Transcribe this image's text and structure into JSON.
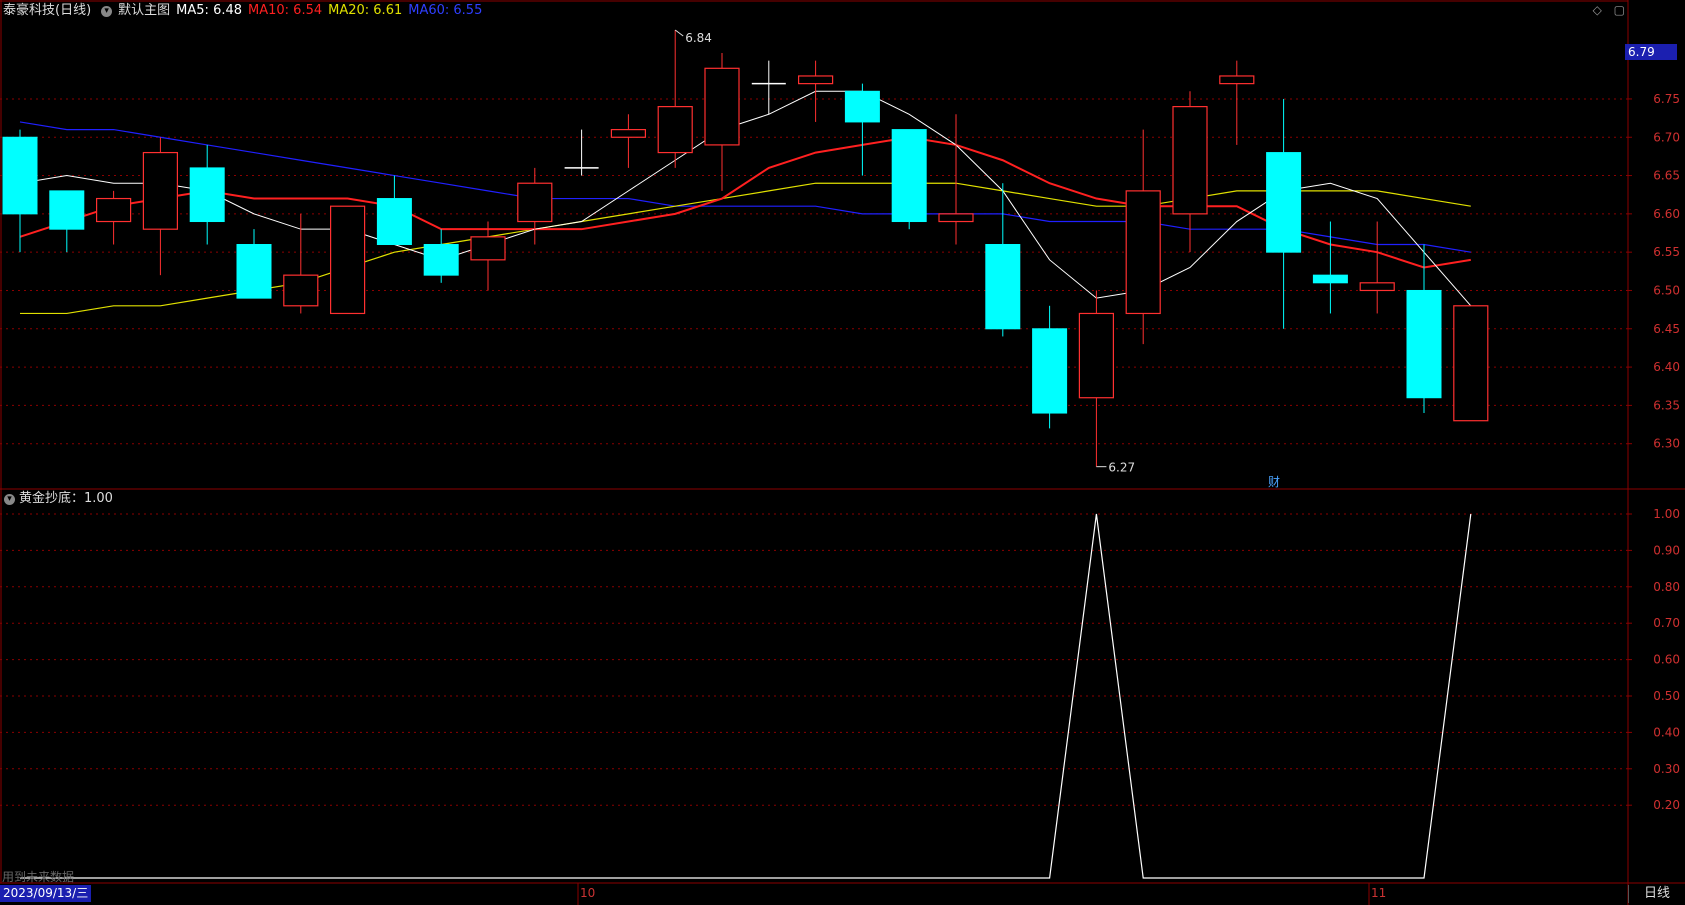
{
  "header": {
    "stock_title": "泰豪科技(日线)",
    "chart_label": "默认主图",
    "ma5": "MA5: 6.48",
    "ma10": "MA10: 6.54",
    "ma20": "MA20: 6.61",
    "ma60": "MA60: 6.55",
    "ma5_color": "#ffffff",
    "ma10_color": "#ff2020",
    "ma20_color": "#e0e000",
    "ma60_color": "#2020ff"
  },
  "indicator_header": {
    "label": "黄金抄底：1.00"
  },
  "current_price_tag": "6.79",
  "annotations": {
    "high": "6.84",
    "low": "6.27",
    "finance_mark": "财"
  },
  "footer": {
    "future_data_note": "用到未来数据",
    "cursor_date": "2023/09/13/三",
    "period": "日线",
    "month_10": "10",
    "month_11": "11"
  },
  "price_axis": [
    "6.75",
    "6.70",
    "6.65",
    "6.60",
    "6.55",
    "6.50",
    "6.45",
    "6.40",
    "6.35",
    "6.30"
  ],
  "indicator_axis": [
    "1.00",
    "0.90",
    "0.80",
    "0.70",
    "0.60",
    "0.50",
    "0.40",
    "0.30",
    "0.20"
  ],
  "colors": {
    "up": "#ff3030",
    "down": "#00ffff",
    "grid": "#8b0000",
    "bg": "#000000"
  },
  "chart_data": {
    "type": "candlestick",
    "candles": [
      {
        "o": 6.7,
        "h": 6.71,
        "l": 6.55,
        "c": 6.6
      },
      {
        "o": 6.63,
        "h": 6.63,
        "l": 6.55,
        "c": 6.58
      },
      {
        "o": 6.59,
        "h": 6.63,
        "l": 6.56,
        "c": 6.62
      },
      {
        "o": 6.58,
        "h": 6.7,
        "l": 6.52,
        "c": 6.68
      },
      {
        "o": 6.66,
        "h": 6.69,
        "l": 6.56,
        "c": 6.59
      },
      {
        "o": 6.56,
        "h": 6.58,
        "l": 6.49,
        "c": 6.49
      },
      {
        "o": 6.48,
        "h": 6.6,
        "l": 6.47,
        "c": 6.52
      },
      {
        "o": 6.47,
        "h": 6.61,
        "l": 6.47,
        "c": 6.61
      },
      {
        "o": 6.62,
        "h": 6.65,
        "l": 6.56,
        "c": 6.56
      },
      {
        "o": 6.56,
        "h": 6.58,
        "l": 6.51,
        "c": 6.52
      },
      {
        "o": 6.54,
        "h": 6.59,
        "l": 6.5,
        "c": 6.57
      },
      {
        "o": 6.59,
        "h": 6.66,
        "l": 6.56,
        "c": 6.64
      },
      {
        "o": 6.66,
        "h": 6.71,
        "l": 6.65,
        "c": 6.66
      },
      {
        "o": 6.7,
        "h": 6.73,
        "l": 6.66,
        "c": 6.71
      },
      {
        "o": 6.68,
        "h": 6.84,
        "l": 6.66,
        "c": 6.74
      },
      {
        "o": 6.69,
        "h": 6.81,
        "l": 6.63,
        "c": 6.79
      },
      {
        "o": 6.77,
        "h": 6.8,
        "l": 6.73,
        "c": 6.77
      },
      {
        "o": 6.77,
        "h": 6.8,
        "l": 6.72,
        "c": 6.78
      },
      {
        "o": 6.76,
        "h": 6.77,
        "l": 6.65,
        "c": 6.72
      },
      {
        "o": 6.71,
        "h": 6.71,
        "l": 6.58,
        "c": 6.59
      },
      {
        "o": 6.59,
        "h": 6.73,
        "l": 6.56,
        "c": 6.6
      },
      {
        "o": 6.56,
        "h": 6.64,
        "l": 6.44,
        "c": 6.45
      },
      {
        "o": 6.45,
        "h": 6.48,
        "l": 6.32,
        "c": 6.34
      },
      {
        "o": 6.36,
        "h": 6.5,
        "l": 6.27,
        "c": 6.47
      },
      {
        "o": 6.47,
        "h": 6.71,
        "l": 6.43,
        "c": 6.63
      },
      {
        "o": 6.6,
        "h": 6.76,
        "l": 6.55,
        "c": 6.74
      },
      {
        "o": 6.77,
        "h": 6.8,
        "l": 6.69,
        "c": 6.78
      },
      {
        "o": 6.68,
        "h": 6.75,
        "l": 6.45,
        "c": 6.55
      },
      {
        "o": 6.52,
        "h": 6.59,
        "l": 6.47,
        "c": 6.51
      },
      {
        "o": 6.5,
        "h": 6.59,
        "l": 6.47,
        "c": 6.51
      },
      {
        "o": 6.5,
        "h": 6.56,
        "l": 6.34,
        "c": 6.36
      },
      {
        "o": 6.33,
        "h": 6.48,
        "l": 6.33,
        "c": 6.48
      }
    ],
    "ma5": [
      6.64,
      6.65,
      6.64,
      6.64,
      6.63,
      6.6,
      6.58,
      6.58,
      6.56,
      6.54,
      6.56,
      6.58,
      6.59,
      6.63,
      6.67,
      6.71,
      6.73,
      6.76,
      6.76,
      6.73,
      6.69,
      6.63,
      6.54,
      6.49,
      6.5,
      6.53,
      6.59,
      6.63,
      6.64,
      6.62,
      6.55,
      6.48
    ],
    "ma10": [
      6.57,
      6.59,
      6.61,
      6.62,
      6.63,
      6.62,
      6.62,
      6.62,
      6.61,
      6.58,
      6.58,
      6.58,
      6.58,
      6.59,
      6.6,
      6.62,
      6.66,
      6.68,
      6.69,
      6.7,
      6.69,
      6.67,
      6.64,
      6.62,
      6.61,
      6.61,
      6.61,
      6.58,
      6.56,
      6.55,
      6.53,
      6.54
    ],
    "ma20": [
      6.47,
      6.47,
      6.48,
      6.48,
      6.49,
      6.5,
      6.51,
      6.53,
      6.55,
      6.56,
      6.57,
      6.58,
      6.59,
      6.6,
      6.61,
      6.62,
      6.63,
      6.64,
      6.64,
      6.64,
      6.64,
      6.63,
      6.62,
      6.61,
      6.61,
      6.62,
      6.63,
      6.63,
      6.63,
      6.63,
      6.62,
      6.61
    ],
    "ma60": [
      6.72,
      6.71,
      6.71,
      6.7,
      6.69,
      6.68,
      6.67,
      6.66,
      6.65,
      6.64,
      6.63,
      6.62,
      6.62,
      6.62,
      6.61,
      6.61,
      6.61,
      6.61,
      6.6,
      6.6,
      6.6,
      6.6,
      6.59,
      6.59,
      6.59,
      6.58,
      6.58,
      6.58,
      6.57,
      6.56,
      6.56,
      6.55
    ],
    "indicator": [
      0,
      0,
      0,
      0,
      0,
      0,
      0,
      0,
      0,
      0,
      0,
      0,
      0,
      0,
      0,
      0,
      0,
      0,
      0,
      0,
      0,
      0,
      0,
      1,
      0,
      0,
      0,
      0,
      0,
      0,
      0,
      1
    ],
    "price_ylim": [
      6.25,
      6.84
    ],
    "indicator_ylim": [
      0,
      1.0
    ]
  }
}
